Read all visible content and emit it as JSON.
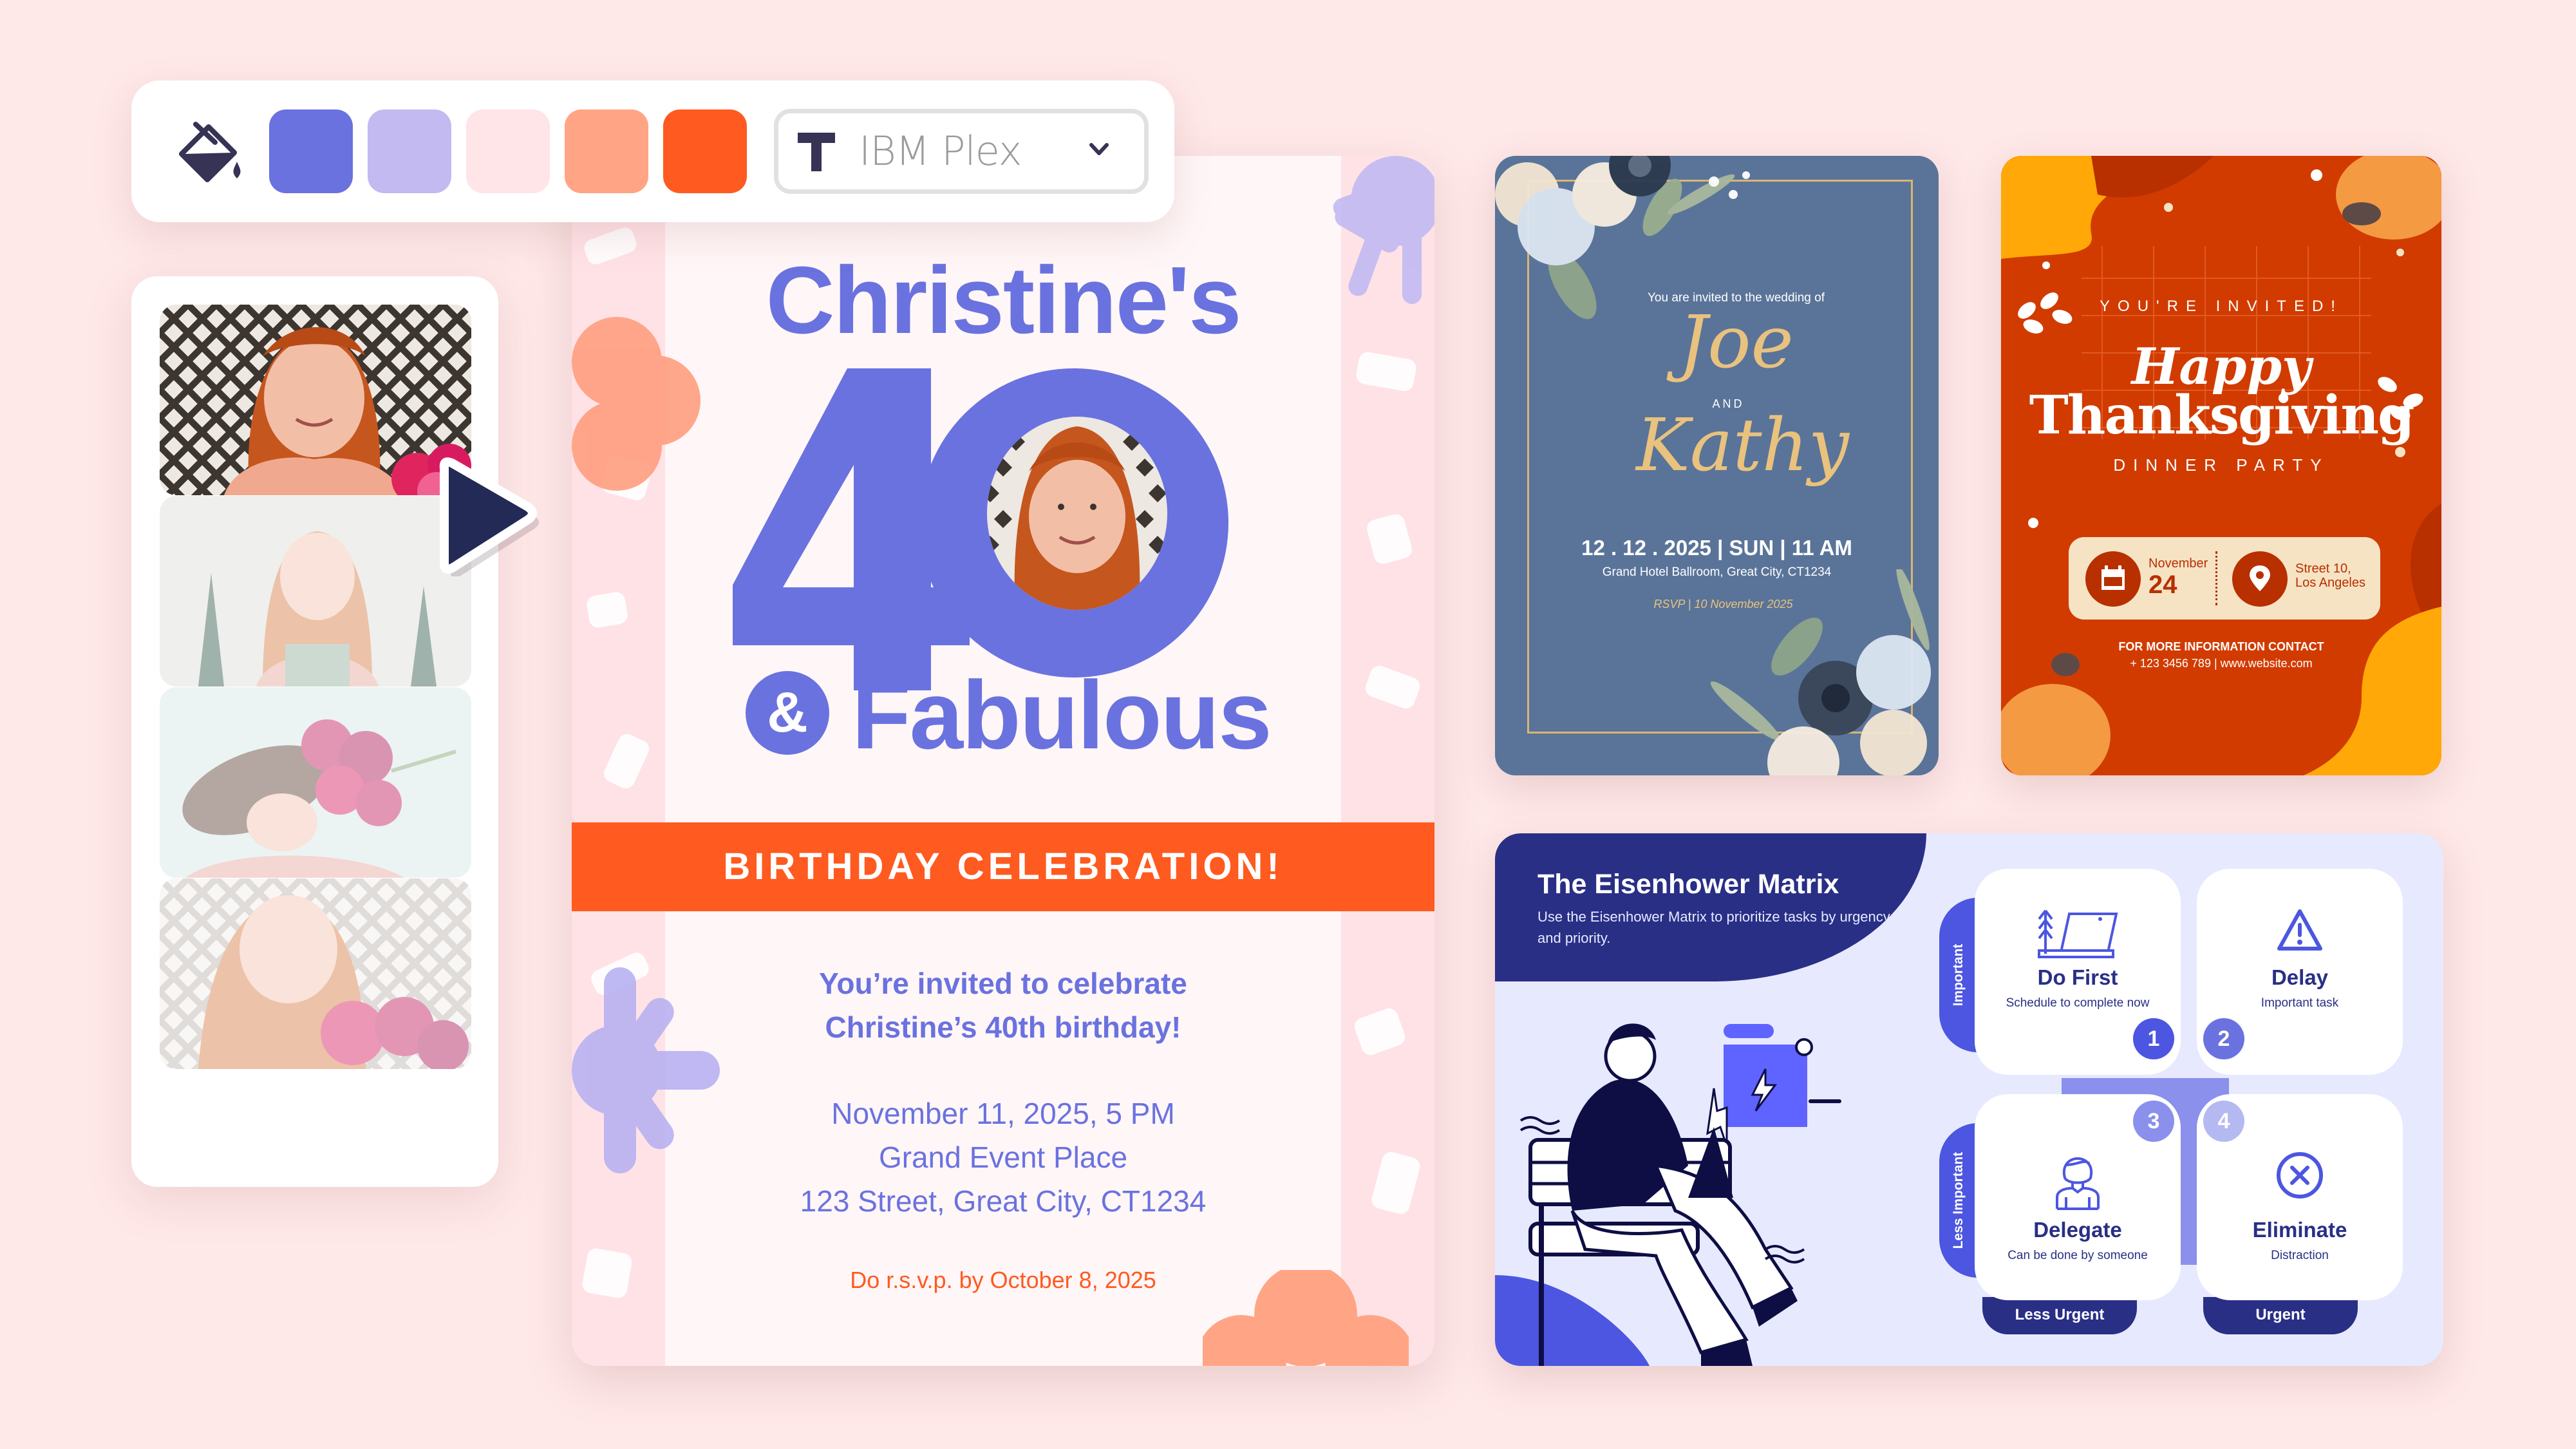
{
  "colors": {
    "background": "#FFE8E8",
    "primary": "#6A72DF",
    "accent": "#FF5A1F",
    "navy": "#292F85",
    "wedding_bg": "#5A7499",
    "wedding_gold": "#E9C27E",
    "thanks_bg": "#D13B00"
  },
  "toolbar": {
    "fill_icon": "paint-bucket-icon",
    "swatches": [
      {
        "name": "periwinkle",
        "color": "#6A72DF"
      },
      {
        "name": "lavender",
        "color": "#C3BAF2"
      },
      {
        "name": "blush",
        "color": "#FFE4E8"
      },
      {
        "name": "peach",
        "color": "#FFA585"
      },
      {
        "name": "orange",
        "color": "#FF5A1F"
      }
    ],
    "font_select": {
      "icon": "text-t-icon",
      "value": "IBM Plex",
      "chevron": "chevron-down-icon"
    }
  },
  "photo_strip": {
    "thumbnails": [
      {
        "label": "Portrait with lattice and flowers",
        "selected": true
      },
      {
        "label": "Portrait in apron with painted trees",
        "selected": false
      },
      {
        "label": "Smelling peony bouquet in hat",
        "selected": false
      },
      {
        "label": "Smiling with peonies at lattice",
        "selected": false
      }
    ],
    "cursor_icon": "play-pointer-icon"
  },
  "birthday_card": {
    "title": "Christine's",
    "number": "40",
    "ampersand": "&",
    "subtitle": "Fabulous",
    "banner": "BIRTHDAY CELEBRATION!",
    "invite_line_1": "You’re invited to celebrate",
    "invite_line_2": "Christine’s 40th birthday!",
    "date": "November 11, 2025, 5 PM",
    "venue": "Grand Event Place",
    "address": "123 Street, Great City, CT1234",
    "rsvp": "Do r.s.v.p. by October 8, 2025"
  },
  "wedding_card": {
    "intro": "You are invited to the wedding of",
    "name_1": "Joe",
    "and": "AND",
    "name_2": "Kathy",
    "date_line": "12 . 12 . 2025 | SUN | 11 AM",
    "venue": "Grand Hotel Ballroom, Great City, CT1234",
    "rsvp": "RSVP | 10 November 2025"
  },
  "thanksgiving_card": {
    "invited": "YOU'RE INVITED!",
    "happy": "Happy",
    "title": "Thanksgiving",
    "subtitle": "DINNER PARTY",
    "month": "November",
    "day": "24",
    "location_line_1": "Street 10,",
    "location_line_2": "Los Angeles",
    "contact_label": "FOR MORE INFORMATION CONTACT",
    "contact_details": "+ 123 3456 789 | www.website.com"
  },
  "eisenhower": {
    "title": "The Eisenhower Matrix",
    "subtitle": "Use the Eisenhower Matrix to prioritize tasks by urgency and priority.",
    "axis_important": "Important",
    "axis_less_important": "Less Important",
    "axis_less_urgent": "Less Urgent",
    "axis_urgent": "Urgent",
    "quadrants": [
      {
        "number": "1",
        "title": "Do First",
        "desc": "Schedule to complete now",
        "icon": "laptop-tree-icon"
      },
      {
        "number": "2",
        "title": "Delay",
        "desc": "Important task",
        "icon": "warning-triangle-icon"
      },
      {
        "number": "3",
        "title": "Delegate",
        "desc": "Can be done by someone",
        "icon": "person-icon"
      },
      {
        "number": "4",
        "title": "Eliminate",
        "desc": "Distraction",
        "icon": "close-circle-icon"
      }
    ]
  }
}
